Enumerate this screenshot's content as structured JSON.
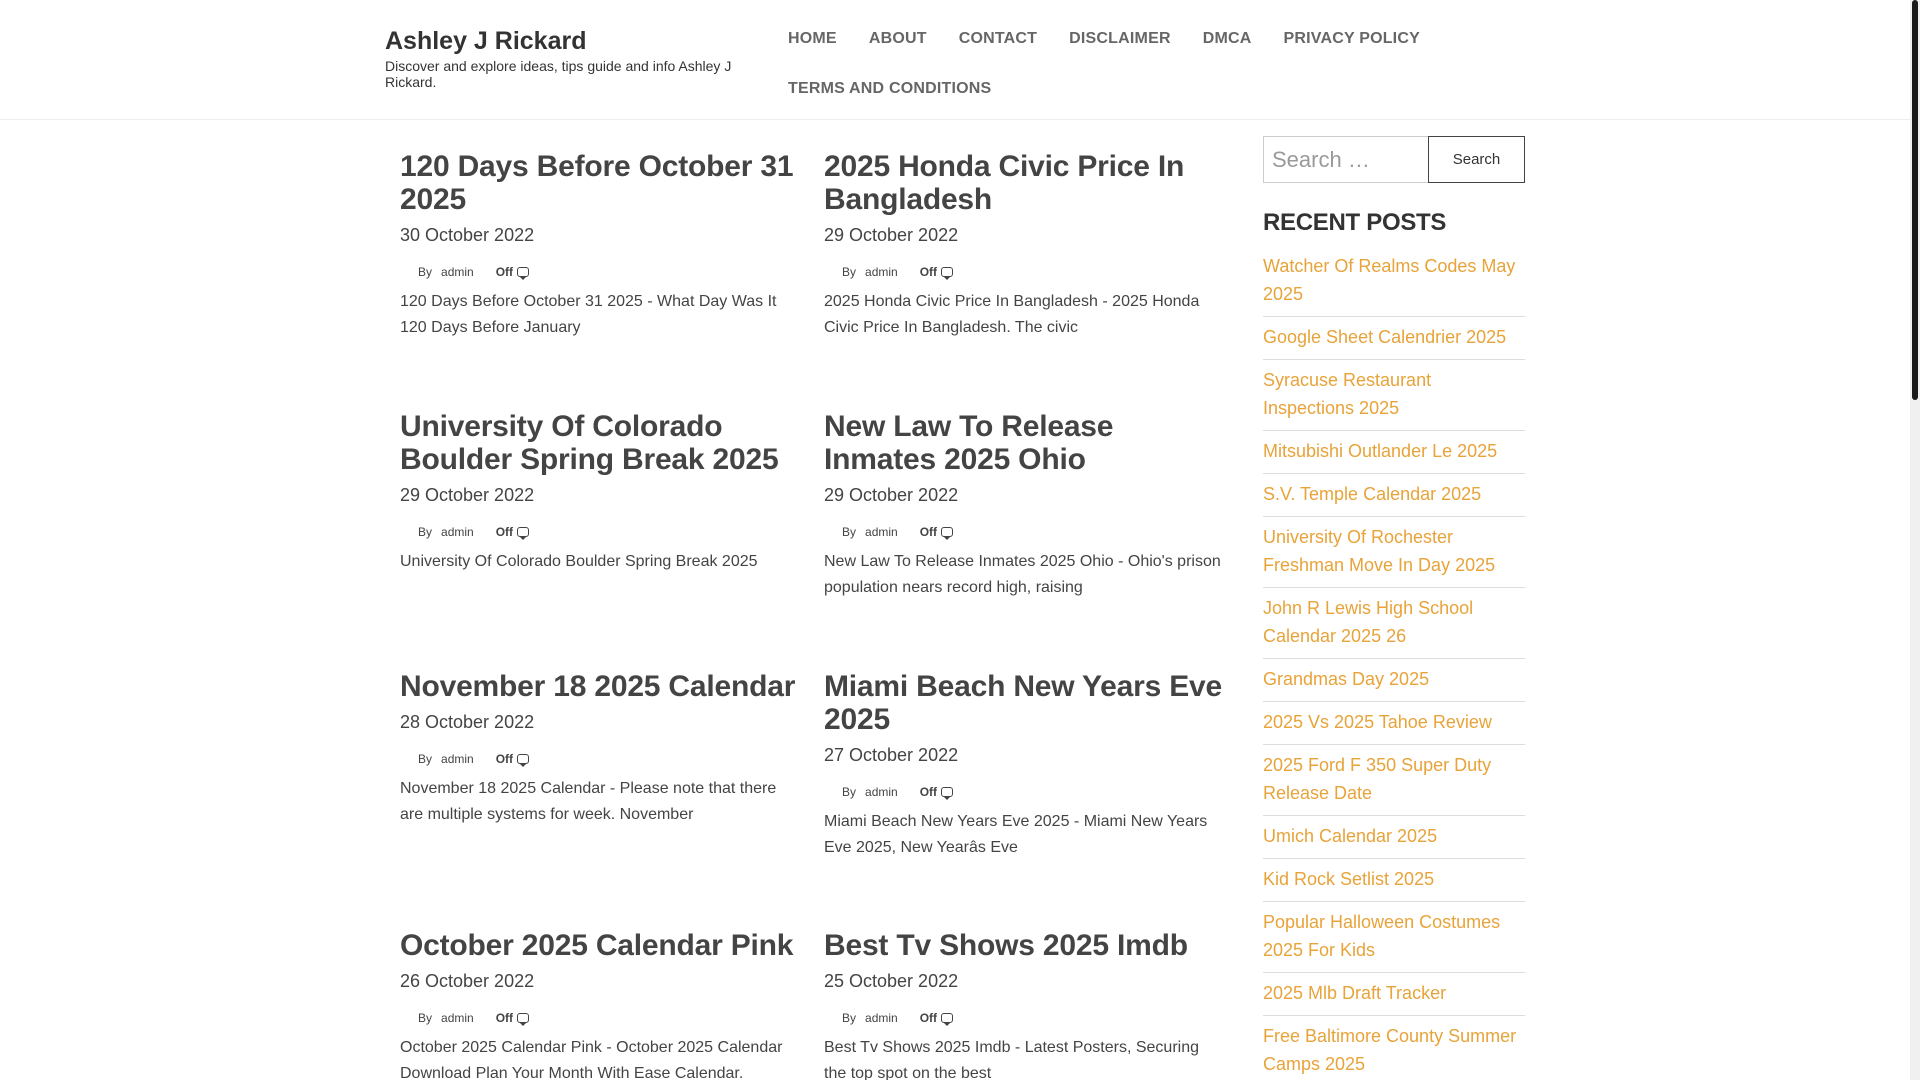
{
  "site": {
    "title": "Ashley J Rickard",
    "description": "Discover and explore ideas, tips guide and info Ashley J Rickard."
  },
  "nav": {
    "items": [
      {
        "label": "HOME"
      },
      {
        "label": "ABOUT"
      },
      {
        "label": "CONTACT"
      },
      {
        "label": "DISCLAIMER"
      },
      {
        "label": "DMCA"
      },
      {
        "label": "PRIVACY POLICY"
      },
      {
        "label": "TERMS AND CONDITIONS"
      }
    ]
  },
  "posts": [
    {
      "title": "120 Days Before October 31 2025",
      "date": "30 October 2022",
      "by": "By",
      "author": "admin",
      "comments": "Off",
      "excerpt": "120 Days Before October 31 2025 - What Day Was It 120 Days Before January"
    },
    {
      "title": "2025 Honda Civic Price In Bangladesh",
      "date": "29 October 2022",
      "by": "By",
      "author": "admin",
      "comments": "Off",
      "excerpt": "2025 Honda Civic Price In Bangladesh - 2025 Honda Civic Price In Bangladesh. The civic"
    },
    {
      "title": "University Of Colorado Boulder Spring Break 2025",
      "date": "29 October 2022",
      "by": "By",
      "author": "admin",
      "comments": "Off",
      "excerpt": "University Of Colorado Boulder Spring Break 2025"
    },
    {
      "title": "New Law To Release Inmates 2025 Ohio",
      "date": "29 October 2022",
      "by": "By",
      "author": "admin",
      "comments": "Off",
      "excerpt": "New Law To Release Inmates 2025 Ohio - Ohio's prison population nears record high, raising"
    },
    {
      "title": "November 18 2025 Calendar",
      "date": "28 October 2022",
      "by": "By",
      "author": "admin",
      "comments": "Off",
      "excerpt": "November 18 2025 Calendar - Please note that there are multiple systems for week. November"
    },
    {
      "title": "Miami Beach New Years Eve 2025",
      "date": "27 October 2022",
      "by": "By",
      "author": "admin",
      "comments": "Off",
      "excerpt": "Miami Beach New Years Eve 2025 - Miami New Years Eve 2025, New Yearâs Eve"
    },
    {
      "title": "October 2025 Calendar Pink",
      "date": "26 October 2022",
      "by": "By",
      "author": "admin",
      "comments": "Off",
      "excerpt": "October 2025 Calendar Pink - October 2025 Calendar Download Plan Your Month With Ease Calendar."
    },
    {
      "title": "Best Tv Shows 2025 Imdb",
      "date": "25 October 2022",
      "by": "By",
      "author": "admin",
      "comments": "Off",
      "excerpt": "Best Tv Shows 2025 Imdb - Latest Posters, Securing the top spot on the best"
    }
  ],
  "sidebar": {
    "search_placeholder": "Search …",
    "search_button": "Search",
    "recent_title": "RECENT POSTS",
    "recent_posts": [
      "Watcher Of Realms Codes May 2025",
      "Google Sheet Calendrier 2025",
      "Syracuse Restaurant Inspections 2025",
      "Mitsubishi Outlander Le 2025",
      "S.V. Temple Calendar 2025",
      "University Of Rochester Freshman Move In Day 2025",
      "John R Lewis High School Calendar 2025 26",
      "Grandmas Day 2025",
      "2025 Vs 2025 Tahoe Review",
      "2025 Ford F 350 Super Duty Release Date",
      "Umich Calendar 2025",
      "Kid Rock Setlist 2025",
      "Popular Halloween Costumes 2025 For Kids",
      "2025 Mlb Draft Tracker",
      "Free Baltimore County Summer Camps 2025"
    ]
  },
  "colors": {
    "link_accent": "#e8a339",
    "heading": "#444444",
    "nav": "#666666"
  }
}
